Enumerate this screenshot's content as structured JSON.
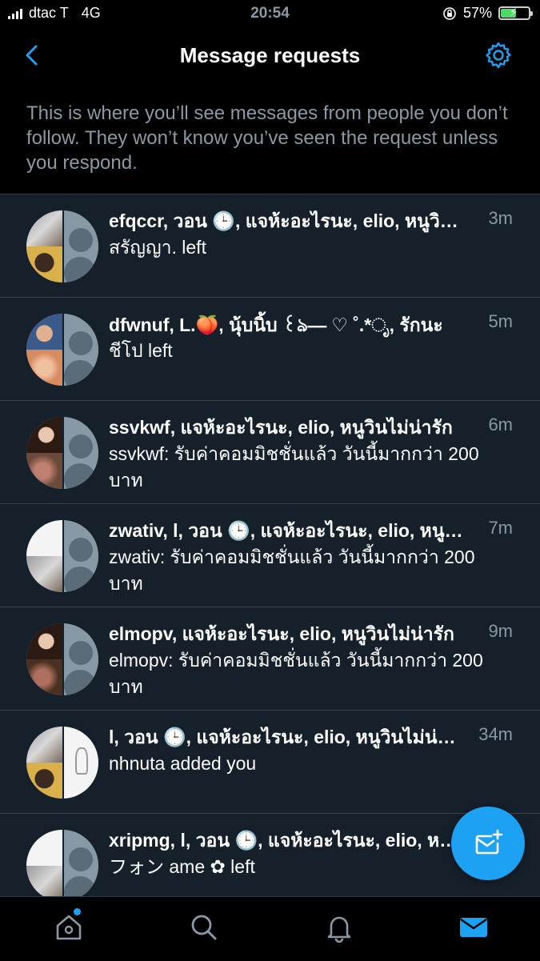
{
  "status_bar": {
    "carrier": "dtac T",
    "network": "4G",
    "time": "20:54",
    "battery": "57%",
    "battery_level": 0.57
  },
  "header": {
    "title": "Message requests",
    "description": "This is where you’ll see messages from people you don’t follow. They won’t know you’ve seen the request unless you respond."
  },
  "conversations": [
    {
      "name": "efqccr, วอน 🕒, แจห้ะอะไรนะ, elio, หนูวินไม่น่ารัก",
      "time": "3m",
      "preview": "สรัญญา. left"
    },
    {
      "name": "dfwnuf, L.🍑, นุ้บนิ้บ ꒰ঌ⎯⎯ ♡ ˚.*ೃ, รักนะ",
      "time": "5m",
      "preview": "ชีโป left"
    },
    {
      "name": "ssvkwf, แจห้ะอะไรนะ, elio, หนูวินไม่น่ารัก",
      "time": "6m",
      "preview": "ssvkwf: รับค่าคอมมิชชั่นแล้ว วันนี้มากกว่า 200 บาท"
    },
    {
      "name": "zwativ, l, วอน 🕒, แจห้ะอะไรนะ, elio, หนูวิน",
      "time": "7m",
      "preview": "zwativ: รับค่าคอมมิชชั่นแล้ว วันนี้มากกว่า 200 บาท"
    },
    {
      "name": "elmopv, แจห้ะอะไรนะ, elio, หนูวินไม่น่ารัก",
      "time": "9m",
      "preview": "elmopv: รับค่าคอมมิชชั่นแล้ว วันนี้มากกว่า 200 บาท"
    },
    {
      "name": "l, วอน 🕒, แจห้ะอะไรนะ, elio, หนูวินไม่น่ารัก",
      "time": "34m",
      "preview": "nhnuta added you"
    },
    {
      "name": "xripmg, l, วอน 🕒, แจห้ะอะไรนะ, elio, หนูวิน",
      "time": "",
      "preview": "フォン ame ✿ left"
    }
  ],
  "colors": {
    "background": "#15202b",
    "accent": "#1da1f2",
    "secondary_text": "#8b98a5",
    "divider": "#38444d"
  },
  "icons": {
    "back": "chevron-left-icon",
    "settings": "gear-icon",
    "compose": "new-message-icon",
    "home": "home-icon",
    "search": "search-icon",
    "notifications": "bell-icon",
    "messages": "envelope-icon"
  }
}
